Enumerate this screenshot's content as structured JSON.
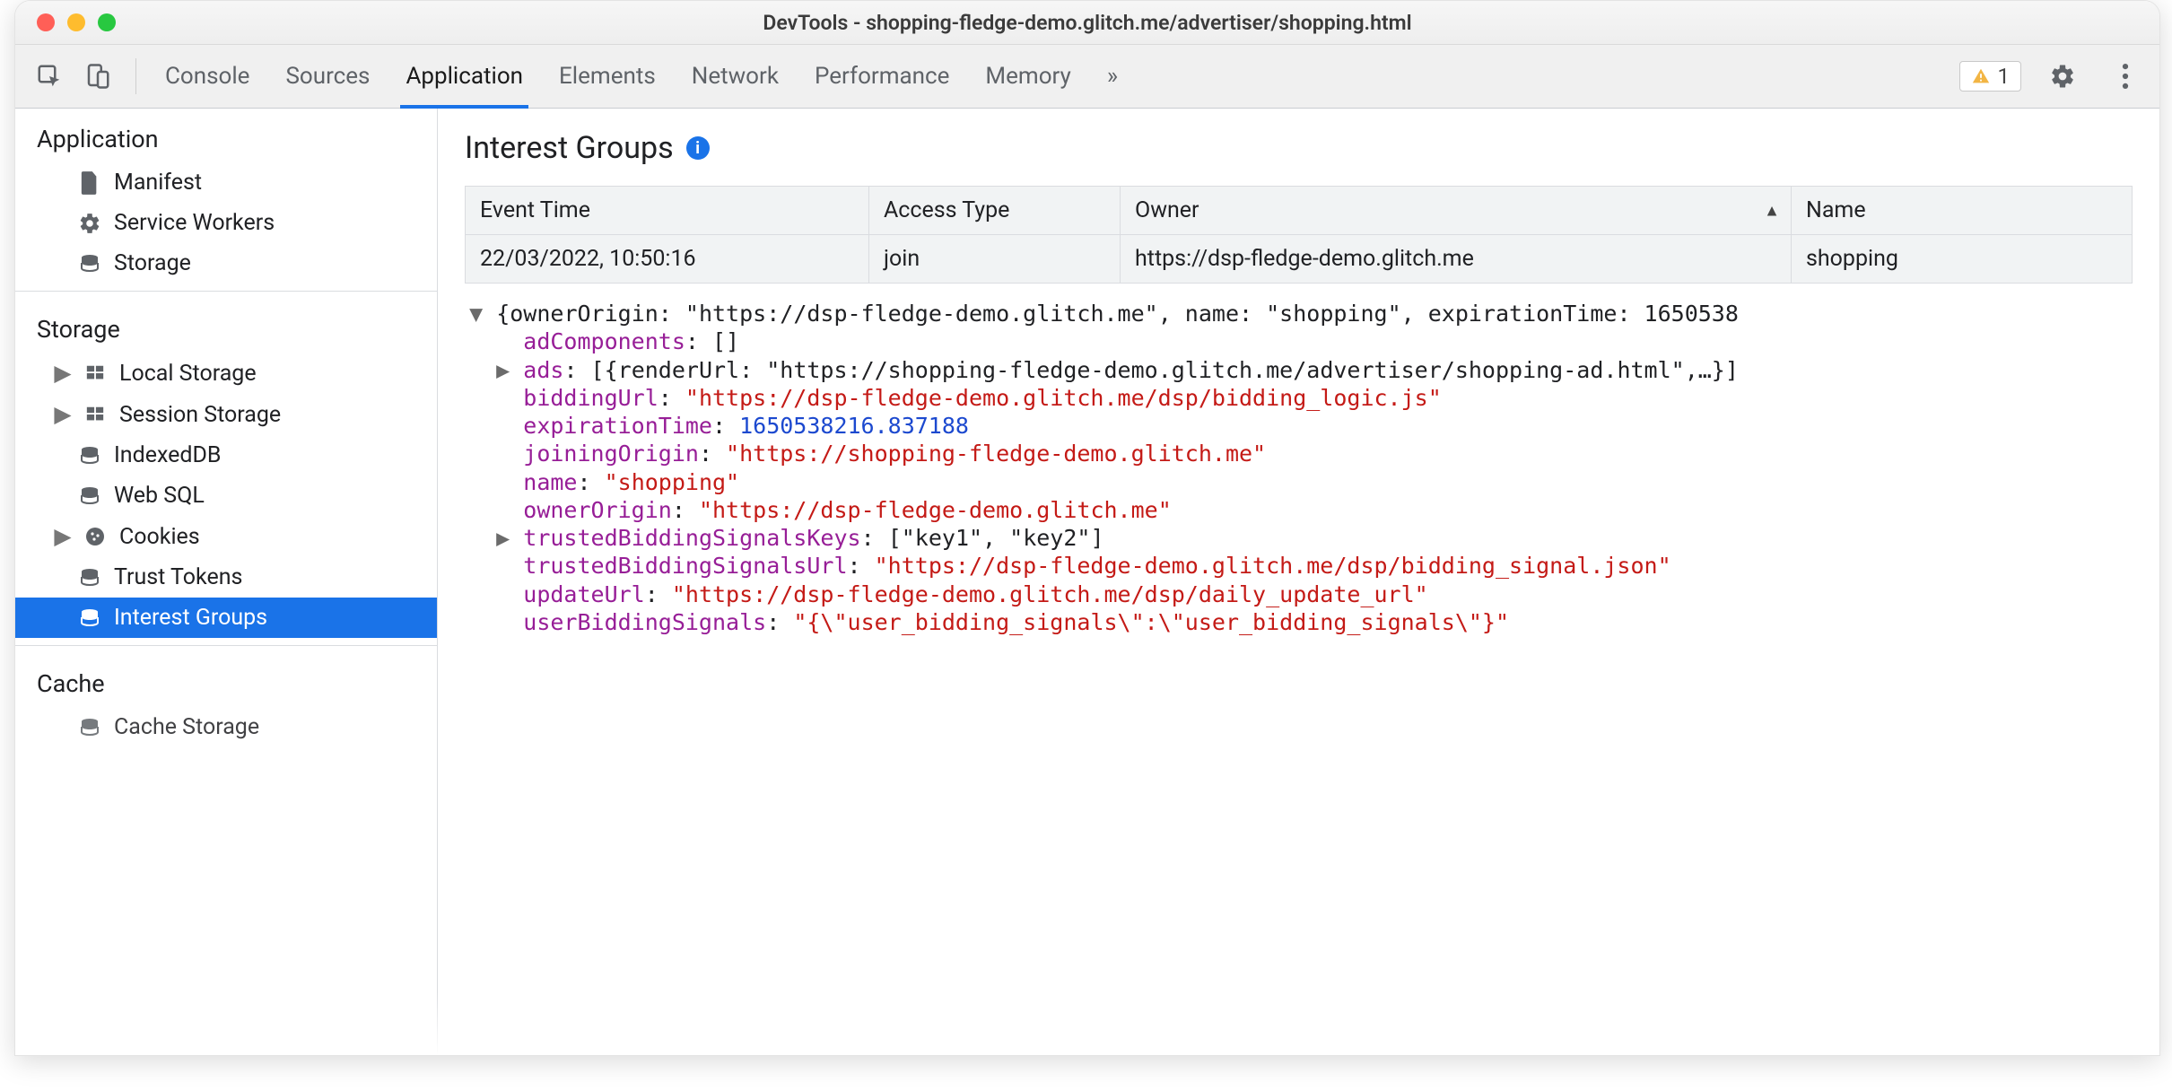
{
  "title": "DevTools - shopping-fledge-demo.glitch.me/advertiser/shopping.html",
  "toolbar": {
    "tabs": [
      "Console",
      "Sources",
      "Application",
      "Elements",
      "Network",
      "Performance",
      "Memory"
    ],
    "active_tab": "Application",
    "more_glyph": "»",
    "warnings_count": "1"
  },
  "sidebar": {
    "sections": [
      {
        "title": "Application",
        "items": [
          {
            "icon": "file",
            "label": "Manifest"
          },
          {
            "icon": "gear",
            "label": "Service Workers"
          },
          {
            "icon": "db",
            "label": "Storage"
          }
        ]
      },
      {
        "title": "Storage",
        "items": [
          {
            "icon": "grid",
            "label": "Local Storage",
            "expandable": true
          },
          {
            "icon": "grid",
            "label": "Session Storage",
            "expandable": true
          },
          {
            "icon": "db",
            "label": "IndexedDB"
          },
          {
            "icon": "db",
            "label": "Web SQL"
          },
          {
            "icon": "cookie",
            "label": "Cookies",
            "expandable": true
          },
          {
            "icon": "db",
            "label": "Trust Tokens"
          },
          {
            "icon": "db",
            "label": "Interest Groups",
            "selected": true
          }
        ]
      },
      {
        "title": "Cache",
        "items": [
          {
            "icon": "db",
            "label": "Cache Storage"
          }
        ]
      }
    ]
  },
  "page": {
    "heading": "Interest Groups",
    "table": {
      "headers": [
        "Event Time",
        "Access Type",
        "Owner",
        "Name"
      ],
      "sort_col": 2,
      "rows": [
        [
          "22/03/2022, 10:50:16",
          "join",
          "https://dsp-fledge-demo.glitch.me",
          "shopping"
        ]
      ]
    },
    "detail": {
      "top_summary": "{ownerOrigin: \"https://dsp-fledge-demo.glitch.me\", name: \"shopping\", expirationTime: 1650538",
      "fields": {
        "adComponents": "[]",
        "ads_summary": "[{renderUrl: \"https://shopping-fledge-demo.glitch.me/advertiser/shopping-ad.html\",…}]",
        "biddingUrl": "\"https://dsp-fledge-demo.glitch.me/dsp/bidding_logic.js\"",
        "expirationTime": "1650538216.837188",
        "joiningOrigin": "\"https://shopping-fledge-demo.glitch.me\"",
        "name": "\"shopping\"",
        "ownerOrigin": "\"https://dsp-fledge-demo.glitch.me\"",
        "trustedBiddingSignalsKeys": "[\"key1\", \"key2\"]",
        "trustedBiddingSignalsUrl": "\"https://dsp-fledge-demo.glitch.me/dsp/bidding_signal.json\"",
        "updateUrl": "\"https://dsp-fledge-demo.glitch.me/dsp/daily_update_url\"",
        "userBiddingSignals": "\"{\\\"user_bidding_signals\\\":\\\"user_bidding_signals\\\"}\""
      }
    }
  }
}
